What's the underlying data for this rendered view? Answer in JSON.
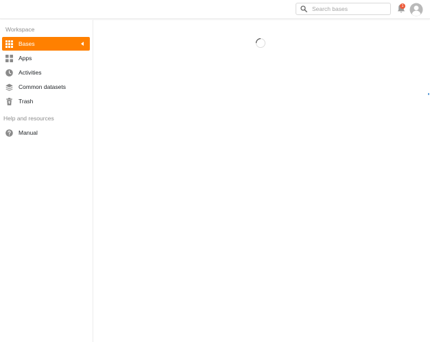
{
  "header": {
    "search": {
      "placeholder": "Search bases",
      "value": ""
    },
    "notifications": {
      "count": "1",
      "icon": "bell-icon"
    },
    "avatar": {
      "icon": "user-avatar-icon"
    }
  },
  "sidebar": {
    "workspace_title": "Workspace",
    "items": [
      {
        "label": "Bases",
        "icon": "grid-icon",
        "active": true
      },
      {
        "label": "Apps",
        "icon": "apps-icon",
        "active": false
      },
      {
        "label": "Activities",
        "icon": "clock-icon",
        "active": false
      },
      {
        "label": "Common datasets",
        "icon": "layers-icon",
        "active": false
      },
      {
        "label": "Trash",
        "icon": "trash-icon",
        "active": false
      }
    ],
    "help_title": "Help and resources",
    "help_items": [
      {
        "label": "Manual",
        "icon": "question-icon"
      }
    ]
  },
  "colors": {
    "accent": "#ff8000",
    "badge": "#ed5b3b",
    "icon_gray": "#8a8a8a"
  }
}
